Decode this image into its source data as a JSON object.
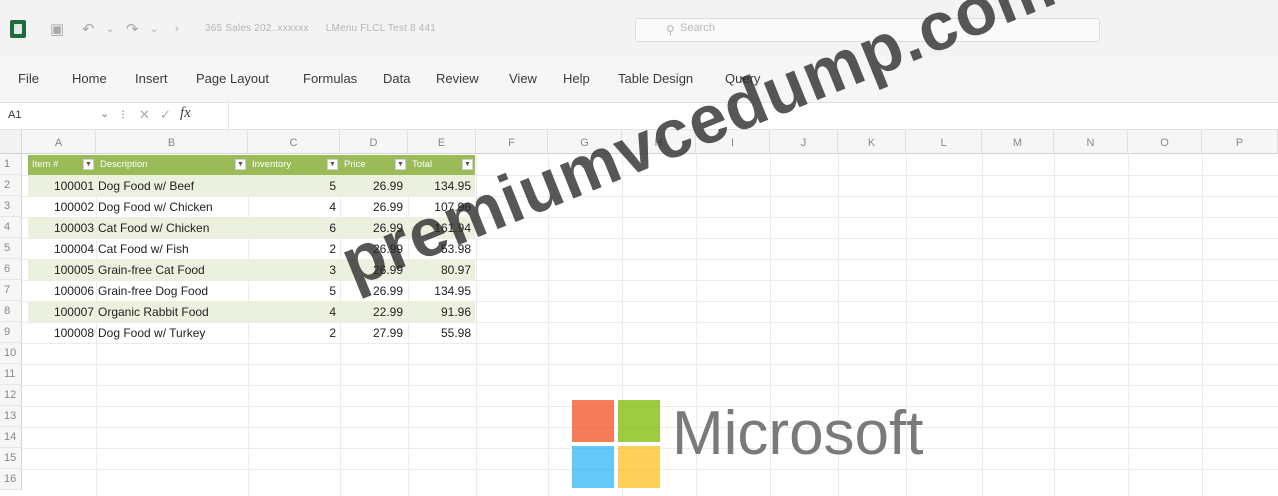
{
  "titlebar": {
    "doc_parts": [
      "365 Sales 202..xxxxxx",
      "LMenu FLCL Test 8 441"
    ],
    "search_placeholder": "Search"
  },
  "ribbon": {
    "tabs": [
      "File",
      "Home",
      "Insert",
      "Page Layout",
      "Formulas",
      "Data",
      "Review",
      "View",
      "Help",
      "Table Design",
      "Query"
    ]
  },
  "formula_bar": {
    "name_box": "A1",
    "fx": "fx",
    "value": ""
  },
  "columns": [
    "A",
    "B",
    "C",
    "D",
    "E",
    "F",
    "G",
    "H",
    "I",
    "J",
    "K",
    "L",
    "M",
    "N",
    "O",
    "P"
  ],
  "rows": [
    "1",
    "2",
    "3",
    "4",
    "5",
    "6",
    "7",
    "8",
    "9",
    "10",
    "11",
    "12",
    "13",
    "14",
    "15",
    "16"
  ],
  "table": {
    "headers": [
      "Item #",
      "Description",
      "Inventory",
      "Price",
      "Total"
    ],
    "rows": [
      [
        "100001",
        "Dog Food w/ Beef",
        "5",
        "26.99",
        "134.95"
      ],
      [
        "100002",
        "Dog Food w/ Chicken",
        "4",
        "26.99",
        "107.96"
      ],
      [
        "100003",
        "Cat Food w/ Chicken",
        "6",
        "26.99",
        "161.94"
      ],
      [
        "100004",
        "Cat Food w/ Fish",
        "2",
        "26.99",
        "53.98"
      ],
      [
        "100005",
        "Grain-free Cat Food",
        "3",
        "26.99",
        "80.97"
      ],
      [
        "100006",
        "Grain-free Dog Food",
        "5",
        "26.99",
        "134.95"
      ],
      [
        "100007",
        "Organic Rabbit Food",
        "4",
        "22.99",
        "91.96"
      ],
      [
        "100008",
        "Dog Food w/ Turkey",
        "2",
        "27.99",
        "55.98"
      ]
    ],
    "header_color": "#9bbb59",
    "band_color": "#ebf1de"
  },
  "watermark": "premiumvcedump.com",
  "logo": {
    "text": "Microsoft",
    "colors": [
      "#f25022",
      "#7fba00",
      "#00a4ef",
      "#ffb900"
    ]
  }
}
